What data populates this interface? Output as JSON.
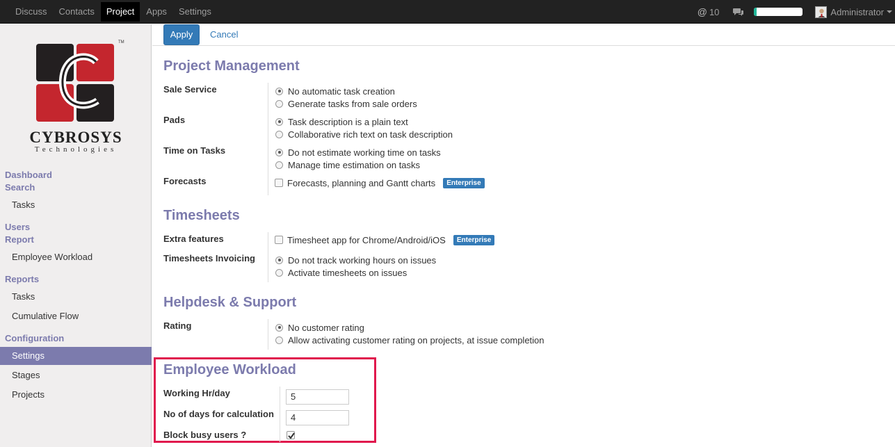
{
  "topbar": {
    "menus": [
      "Discuss",
      "Contacts",
      "Project",
      "Apps",
      "Settings"
    ],
    "active_menu": "Project",
    "message_count": "10",
    "progress_fraction": 0.05,
    "user_name": "Administrator"
  },
  "sidebar": {
    "logo_text": "CYBROSYS",
    "logo_sub": "Technologies",
    "groups": [
      {
        "head1": "Dashboard",
        "head2": "Search",
        "items": [
          "Tasks"
        ]
      },
      {
        "head1": "Users",
        "head2": "Report",
        "items": [
          "Employee Workload"
        ]
      },
      {
        "head1": "Reports",
        "items": [
          "Tasks",
          "Cumulative Flow"
        ]
      },
      {
        "head1": "Configuration",
        "items": [
          "Settings",
          "Stages",
          "Projects"
        ]
      }
    ],
    "active_item": "Settings"
  },
  "controls": {
    "apply_label": "Apply",
    "cancel_label": "Cancel"
  },
  "sections": {
    "project_management": {
      "title": "Project Management",
      "sale_service": {
        "label": "Sale Service",
        "opt1": "No automatic task creation",
        "opt2": "Generate tasks from sale orders"
      },
      "pads": {
        "label": "Pads",
        "opt1": "Task description is a plain text",
        "opt2": "Collaborative rich text on task description"
      },
      "time_on_tasks": {
        "label": "Time on Tasks",
        "opt1": "Do not estimate working time on tasks",
        "opt2": "Manage time estimation on tasks"
      },
      "forecasts": {
        "label": "Forecasts",
        "opt1": "Forecasts, planning and Gantt charts",
        "badge": "Enterprise"
      }
    },
    "timesheets": {
      "title": "Timesheets",
      "extra_features": {
        "label": "Extra features",
        "opt1": "Timesheet app for Chrome/Android/iOS",
        "badge": "Enterprise"
      },
      "invoicing": {
        "label": "Timesheets Invoicing",
        "opt1": "Do not track working hours on issues",
        "opt2": "Activate timesheets on issues"
      }
    },
    "helpdesk": {
      "title": "Helpdesk & Support",
      "rating": {
        "label": "Rating",
        "opt1": "No customer rating",
        "opt2": "Allow activating customer rating on projects, at issue completion"
      }
    },
    "employee_workload": {
      "title": "Employee Workload",
      "working_hr_label": "Working Hr/day",
      "working_hr_value": "5",
      "days_label": "No of days for calculation",
      "days_value": "4",
      "block_label": "Block busy users ?",
      "block_checked": true
    }
  },
  "colors": {
    "accent": "#7c7bad",
    "primary": "#337ab7",
    "highlight": "#e0184d"
  }
}
